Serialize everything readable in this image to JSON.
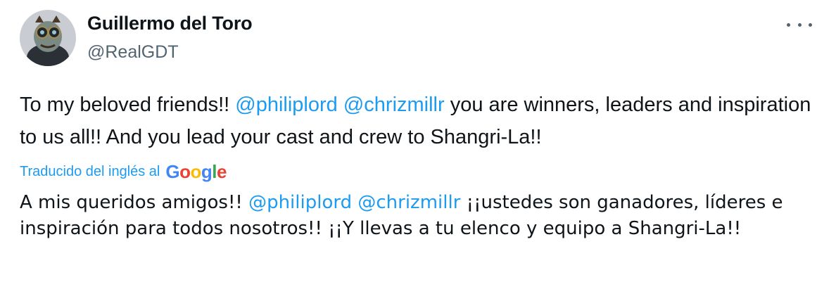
{
  "author": {
    "name": "Guillermo del Toro",
    "handle": "@RealGDT",
    "avatar_icon": "avatar-photo"
  },
  "tweet": {
    "part1": "To my beloved friends!!  ",
    "mention1": "@philiplord",
    "space": " ",
    "mention2": "@chrizmillr",
    "part2": " you are winners, leaders and inspiration to us all!! And you lead your cast and crew to Shangri-La!!"
  },
  "translation_notice": {
    "label": "Traducido del inglés al",
    "provider": "Google"
  },
  "translation": {
    "part1": "A mis queridos amigos!! ",
    "mention1": "@philiplord",
    "space": " ",
    "mention2": "@chrizmillr",
    "part2": " ¡¡ustedes son ganadores, líderes e inspiración para todos nosotros!! ¡¡Y llevas a tu elenco y equipo a Shangri-La!!"
  },
  "colors": {
    "link": "#1d9bf0",
    "text": "#0f1419",
    "secondary": "#536471"
  }
}
